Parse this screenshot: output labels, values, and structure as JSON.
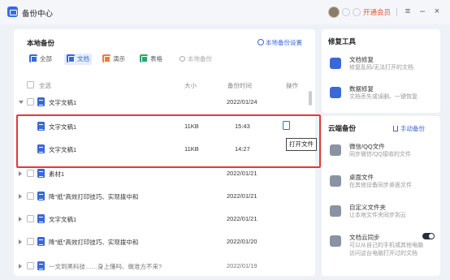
{
  "app": {
    "title": "备份中心",
    "vip": "开通会员",
    "menu_glyph": "≡",
    "min_glyph": "–",
    "close_glyph": "×"
  },
  "backup": {
    "title": "本地备份",
    "settings_link": "本地备份设置",
    "filters": [
      "全部",
      "文档",
      "演示",
      "表格"
    ],
    "search_placeholder": "本地备份",
    "headers": {
      "select_all": "全选",
      "size": "大小",
      "time": "备份时间",
      "action": "操作"
    },
    "rows": [
      {
        "name": "文字文稿1",
        "size": "",
        "time": "2022/01/24",
        "expand": "down"
      },
      {
        "name": "文字文稿1",
        "size": "11KB",
        "time": "15:43",
        "expand": ""
      },
      {
        "name": "文字文稿1",
        "size": "11KB",
        "time": "14:27",
        "expand": ""
      },
      {
        "name": "素材1",
        "size": "",
        "time": "2022/01/21",
        "expand": "right"
      },
      {
        "name": "降\"纸\"高效打印技巧、实现拨中和",
        "size": "",
        "time": "2022/01/21",
        "expand": "right"
      },
      {
        "name": "文字文稿1",
        "size": "",
        "time": "2022/01/21",
        "expand": "right"
      },
      {
        "name": "降\"纸\"高效打印技巧、实现拨中和",
        "size": "",
        "time": "2022/01/20",
        "expand": "right"
      },
      {
        "name": "一文到黑科技……身上懂吗、做准方不来?",
        "size": "",
        "time": "2022/01/19",
        "expand": "right"
      }
    ],
    "tooltip": "打开文件"
  },
  "repair": {
    "title": "修复工具",
    "items": [
      {
        "name": "文档修复",
        "desc": "修复乱码/无法打开的文档"
      },
      {
        "name": "数据修复",
        "desc": "文档丢失或误删、一键恢复"
      }
    ]
  },
  "cloud": {
    "title": "云端备份",
    "manual": "手动备份",
    "items": [
      {
        "name": "微信/QQ文件",
        "desc": "同步微信/QQ接收的文件"
      },
      {
        "name": "桌面文件",
        "desc": "在其他设备同步桌面文件"
      },
      {
        "name": "自定义文件夹",
        "desc": "让本地文件夹同步到云"
      },
      {
        "name": "文档云同步",
        "desc": "可以从自己的手机或其他电脑",
        "desc2": "访问这台电脑打开过的文档"
      }
    ]
  },
  "colors": {
    "accent": "#3a68d6",
    "highlight": "#e53935",
    "vip": "#e8553a"
  }
}
